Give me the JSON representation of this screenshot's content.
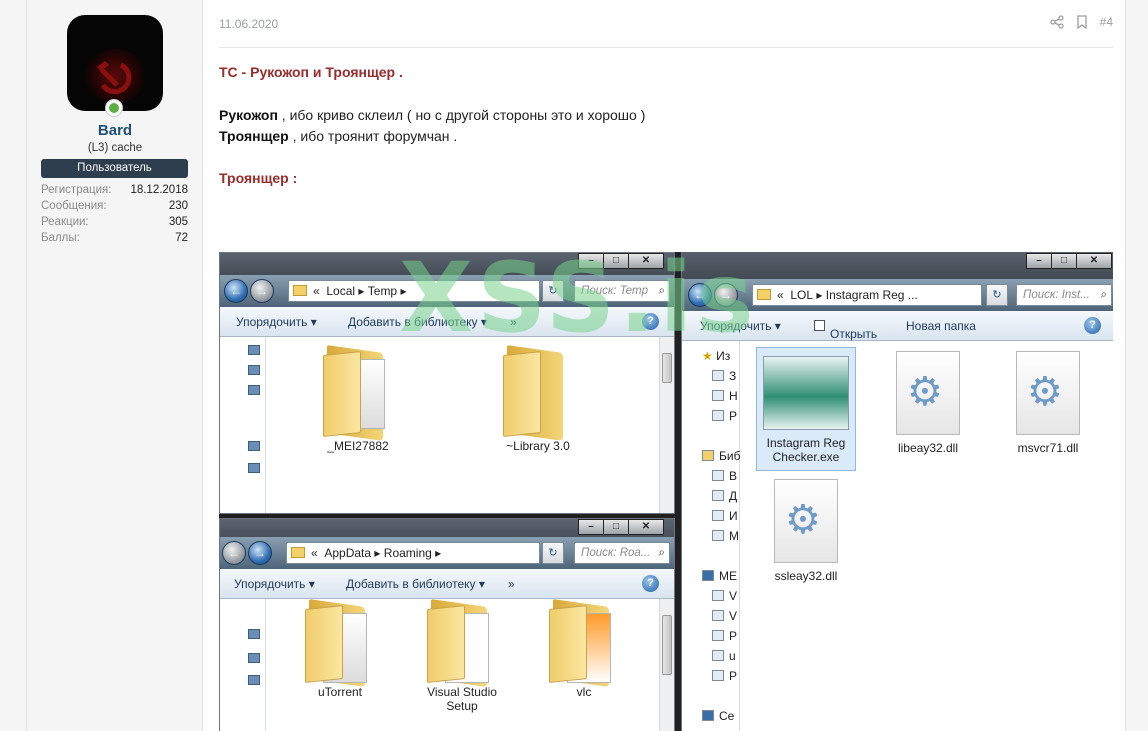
{
  "user": {
    "username": "Bard",
    "user_title": "(L3) cache",
    "banner": "Пользователь",
    "stats": [
      {
        "label": "Регистрация:",
        "value": "18.12.2018"
      },
      {
        "label": "Сообщения:",
        "value": "230"
      },
      {
        "label": "Реакции:",
        "value": "305"
      },
      {
        "label": "Баллы:",
        "value": "72"
      }
    ]
  },
  "post": {
    "date": "11.06.2020",
    "number": "#4",
    "headline": "ТС - Рукожоп и Троянщер .",
    "line1_bold": "Рукожоп",
    "line1_rest": " , ибо криво склеил ( но с другой стороны это и хорошо )",
    "line2_bold": "Троянщер",
    "line2_rest": " , ибо троянит форумчан .",
    "subheading": "Троянщер :"
  },
  "screenshot": {
    "watermark": "XSS.is",
    "win_temp": {
      "crumbs": [
        "«",
        "Local",
        "▸",
        "Temp",
        "▸"
      ],
      "search": "Поиск: Temp",
      "toolbar": [
        "Упорядочить ▾",
        "Добавить в библиотеку ▾",
        "»"
      ],
      "items": [
        "_MEI27882",
        "~Library 3.0"
      ]
    },
    "win_roaming": {
      "crumbs": [
        "«",
        "AppData",
        "▸",
        "Roaming",
        "▸"
      ],
      "search": "Поиск: Roa...",
      "toolbar": [
        "Упорядочить ▾",
        "Добавить в библиотеку ▾",
        "»"
      ],
      "items": [
        "uTorrent",
        "Visual Studio Setup",
        "vlc"
      ]
    },
    "win_lol": {
      "crumbs": [
        "«",
        "LOL",
        "▸",
        "Instagram Reg ..."
      ],
      "search": "Поиск: Inst...",
      "toolbar": [
        "Упорядочить ▾",
        "Открыть",
        "Новая папка"
      ],
      "tree": [
        "Из",
        "З",
        "Н",
        "Р",
        "Биб",
        "В",
        "Д",
        "И",
        "М",
        "МЕ",
        "V",
        "V",
        "Р",
        "u",
        "Р",
        "Се"
      ],
      "items": [
        "Instagram Reg Checker.exe",
        "libeay32.dll",
        "msvcr71.dll",
        "ssleay32.dll"
      ]
    }
  }
}
